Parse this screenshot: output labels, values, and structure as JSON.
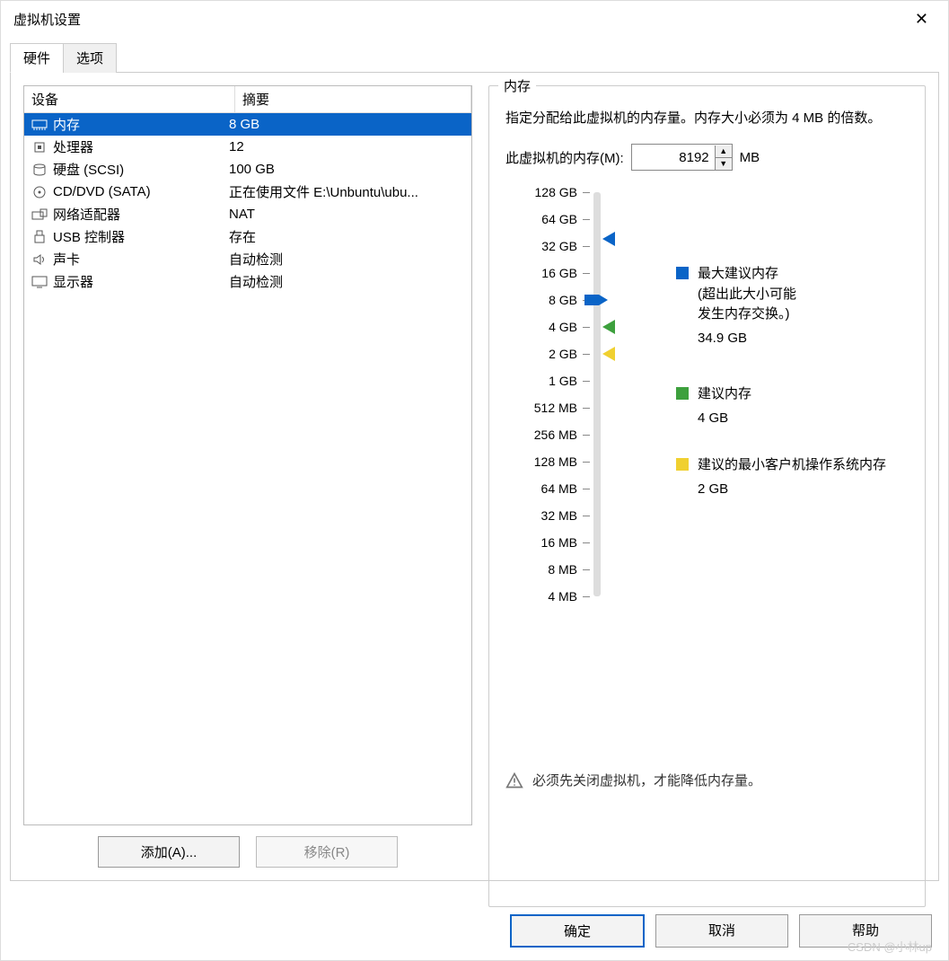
{
  "window": {
    "title": "虚拟机设置"
  },
  "tabs": {
    "hardware": "硬件",
    "options": "选项"
  },
  "columns": {
    "device": "设备",
    "summary": "摘要"
  },
  "hw": [
    {
      "icon": "memory-icon",
      "name": "内存",
      "summary": "8 GB",
      "selected": true
    },
    {
      "icon": "cpu-icon",
      "name": "处理器",
      "summary": "12"
    },
    {
      "icon": "disk-icon",
      "name": "硬盘 (SCSI)",
      "summary": "100 GB"
    },
    {
      "icon": "cd-icon",
      "name": "CD/DVD (SATA)",
      "summary": "正在使用文件 E:\\Unbuntu\\ubu..."
    },
    {
      "icon": "net-icon",
      "name": "网络适配器",
      "summary": "NAT"
    },
    {
      "icon": "usb-icon",
      "name": "USB 控制器",
      "summary": "存在"
    },
    {
      "icon": "sound-icon",
      "name": "声卡",
      "summary": "自动检测"
    },
    {
      "icon": "display-icon",
      "name": "显示器",
      "summary": "自动检测"
    }
  ],
  "buttons": {
    "add": "添加(A)...",
    "remove": "移除(R)",
    "ok": "确定",
    "cancel": "取消",
    "help": "帮助"
  },
  "mem": {
    "group": "内存",
    "desc": "指定分配给此虚拟机的内存量。内存大小必须为 4 MB 的倍数。",
    "label": "此虚拟机的内存(M):",
    "value": "8192",
    "unit": "MB",
    "ticks": [
      "128 GB",
      "64 GB",
      "32 GB",
      "16 GB",
      "8 GB",
      "4 GB",
      "2 GB",
      "1 GB",
      "512 MB",
      "256 MB",
      "128 MB",
      "64 MB",
      "32 MB",
      "16 MB",
      "8 MB",
      "4 MB"
    ],
    "legend": {
      "max": "最大建议内存",
      "maxnote1": "(超出此大小可能",
      "maxnote2": "发生内存交换。)",
      "maxval": "34.9 GB",
      "rec": "建议内存",
      "recval": "4 GB",
      "min": "建议的最小客户机操作系统内存",
      "minval": "2 GB"
    },
    "warn": "必须先关闭虚拟机，才能降低内存量。"
  },
  "colors": {
    "sel": "#0a64c7",
    "green": "#3da03d",
    "yellow": "#f0d030"
  },
  "watermark": "CSDN @小林up"
}
